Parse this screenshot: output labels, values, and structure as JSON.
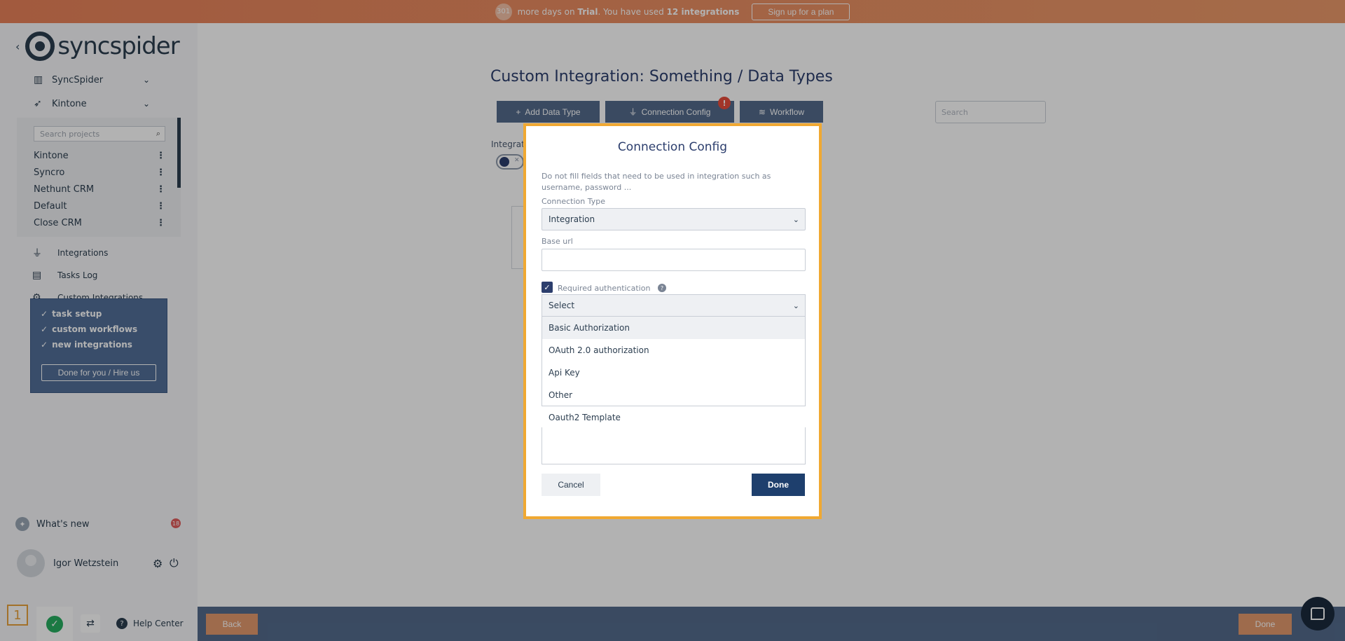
{
  "banner": {
    "days": "301",
    "text_before": "more days on",
    "trial": "Trial",
    "text_mid": ". You have used",
    "integrations_used": "12 integrations",
    "plan_button": "Sign up for a plan"
  },
  "sidebar": {
    "logo_text": "syncspider",
    "workspaces": [
      {
        "label": "SyncSpider",
        "icon": "building-icon"
      },
      {
        "label": "Kintone",
        "icon": "rocket-icon"
      }
    ],
    "search_placeholder": "Search projects",
    "projects": [
      "Kintone",
      "Syncro",
      "Nethunt CRM",
      "Default",
      "Close CRM"
    ],
    "nav": [
      {
        "label": "Integrations",
        "icon": "plug-icon"
      },
      {
        "label": "Tasks Log",
        "icon": "clipboard-icon"
      },
      {
        "label": "Custom Integrations",
        "icon": "gear-icon"
      }
    ],
    "promo": {
      "features": [
        "task setup",
        "custom workflows",
        "new integrations"
      ],
      "button": "Done for you / Hire us"
    },
    "whats_new": "What's new",
    "whats_new_count": "18",
    "user_name": "Igor Wetzstein",
    "help_center": "Help Center",
    "tray_number": "1"
  },
  "main": {
    "title": "Custom Integration: Something / Data Types",
    "toolbar": {
      "add": "Add Data Type",
      "connection": "Connection Config",
      "workflow": "Workflow",
      "alert": "!"
    },
    "search_placeholder": "Search",
    "integration_label": "Integrat",
    "back": "Back",
    "done": "Done"
  },
  "modal": {
    "title": "Connection Config",
    "note": "Do not fill fields that need to be used in integration such as username, password ...",
    "connection_type_label": "Connection Type",
    "connection_type_value": "Integration",
    "base_url_label": "Base url",
    "base_url_value": "",
    "required_auth_label": "Required authentication",
    "auth_select_value": "Select",
    "auth_options": [
      "Basic Authorization",
      "OAuth 2.0 authorization",
      "Api Key",
      "Other",
      "Oauth2 Template"
    ],
    "cancel": "Cancel",
    "done": "Done"
  },
  "colors": {
    "banner": "#e9825a",
    "primary": "#2c3e6d",
    "toolbar": "#536b8c",
    "accent_orange": "#e39a6e",
    "modal_border": "#f0a832",
    "alert": "#e74c3c"
  }
}
